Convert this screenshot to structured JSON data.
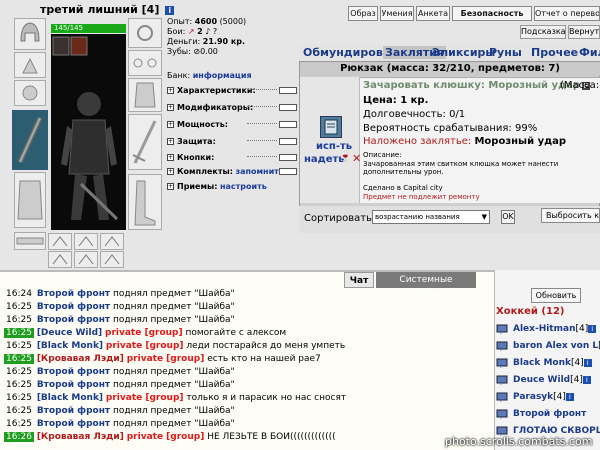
{
  "character": {
    "name": "третий лишний",
    "level": "[4]",
    "hp": "145/145",
    "info_icon": "i"
  },
  "stats": {
    "exp_label": "Опыт:",
    "exp_value": "4600",
    "exp_next": "(5000)",
    "fights_label": "Бои:",
    "fights_value": "2",
    "money_label": "Деньги:",
    "money_value": "21.90 кр.",
    "teeth_label": "Зубы:",
    "teeth_value": "0.00"
  },
  "bank": {
    "label": "Банк:",
    "link": "информация"
  },
  "attrs": [
    {
      "label": "Характеристики:"
    },
    {
      "label": "Модификаторы:"
    },
    {
      "label": "Мощность:"
    },
    {
      "label": "Защита:"
    },
    {
      "label": "Кнопки:"
    },
    {
      "label": "Комплекты:",
      "link": "запомнить"
    },
    {
      "label": "Приемы:",
      "link": "настроить"
    }
  ],
  "top_buttons": [
    "Образ",
    "Умения",
    "Анкета",
    "Безопасность",
    "Отчет о переводах"
  ],
  "sub_buttons": [
    "Подсказка",
    "Вернуться"
  ],
  "menu": [
    "Обмундирование",
    "Заклятия",
    "Эликсиры",
    "Руны",
    "Прочее",
    "Фильтр"
  ],
  "backpack": {
    "title": "Рюкзак (масса: 32/210, предметов: 7)"
  },
  "item": {
    "name": "Зачаровать клюшку: Морозный удар",
    "f_icon": "F",
    "mass_label": "(Масса:",
    "price": "Цена: 1 кр.",
    "durability": "Долговечность: 0/1",
    "chance": "Вероятность срабатывания: 99%",
    "enchant_label": "Наложено заклятье:",
    "enchant_value": "Морозный удар",
    "desc_label": "Описание:",
    "desc": "Зачарованная этим свитком клюшка может нанести дополнительны урон.",
    "made": "Сделано в Capital city",
    "no_repair": "Предмет не подлежит ремонту",
    "use_link": "исп-ть",
    "wear_link": "надеть"
  },
  "sort": {
    "label": "Сортировать по",
    "value": "возрастанию названия",
    "ok": "OK",
    "drop_btn": "Выбросить кл"
  },
  "chat_tabs": [
    "Чат",
    "Системные сообщения"
  ],
  "chat": [
    {
      "time": "16:24",
      "green": false,
      "nick": "Второй фронт",
      "nick_red": false,
      "priv": "",
      "text": "поднял предмет \"Шайба\""
    },
    {
      "time": "16:25",
      "green": false,
      "nick": "Второй фронт",
      "nick_red": false,
      "priv": "",
      "text": "поднял предмет \"Шайба\""
    },
    {
      "time": "16:25",
      "green": false,
      "nick": "Второй фронт",
      "nick_red": false,
      "priv": "",
      "text": "поднял предмет \"Шайба\""
    },
    {
      "time": "16:25",
      "green": true,
      "nick": "[Deuce Wild]",
      "nick_red": false,
      "priv": "private [group]",
      "text": "помогайте с алексом"
    },
    {
      "time": "16:25",
      "green": false,
      "nick": "[Black Monk]",
      "nick_red": false,
      "priv": "private [group]",
      "text": "леди постарайся до меня умпеть"
    },
    {
      "time": "16:25",
      "green": true,
      "nick": "[Кровавая Лэди]",
      "nick_red": true,
      "priv": "private [group]",
      "text": "есть кто на нашей рае7"
    },
    {
      "time": "16:25",
      "green": false,
      "nick": "Второй фронт",
      "nick_red": false,
      "priv": "",
      "text": "поднял предмет \"Шайба\""
    },
    {
      "time": "16:25",
      "green": false,
      "nick": "Второй фронт",
      "nick_red": false,
      "priv": "",
      "text": "поднял предмет \"Шайба\""
    },
    {
      "time": "16:25",
      "green": false,
      "nick": "[Black Monk]",
      "nick_red": false,
      "priv": "private [group]",
      "text": "только я и парасик но нас сносят"
    },
    {
      "time": "16:25",
      "green": false,
      "nick": "Второй фронт",
      "nick_red": false,
      "priv": "",
      "text": "поднял предмет \"Шайба\""
    },
    {
      "time": "16:25",
      "green": false,
      "nick": "Второй фронт",
      "nick_red": false,
      "priv": "",
      "text": "поднял предмет \"Шайба\""
    },
    {
      "time": "16:26",
      "green": true,
      "nick": "[Кровавая Лэди]",
      "nick_red": true,
      "priv": "private [group]",
      "text": "НЕ ЛЕЗЬТЕ В БОИ((((((((((((("
    }
  ],
  "players": {
    "refresh": "Обновить",
    "group": "Хоккей (12)",
    "list": [
      {
        "name": "Alex-Hitman",
        "lvl": "[4]",
        "info": "i"
      },
      {
        "name": "baron Alex von L",
        "lvl": "[4]",
        "info": ""
      },
      {
        "name": "Black Monk",
        "lvl": "[4]",
        "info": "i"
      },
      {
        "name": "Deuce Wild",
        "lvl": "[4]",
        "info": "i"
      },
      {
        "name": "Parasyk",
        "lvl": "[4]",
        "info": "i"
      },
      {
        "name": "Второй фронт",
        "lvl": "",
        "info": ""
      },
      {
        "name": "ГЛОТАЮ СКВОРЦ",
        "lvl": "",
        "info": ""
      }
    ]
  },
  "watermark": "photo.scrolls.combats.com"
}
